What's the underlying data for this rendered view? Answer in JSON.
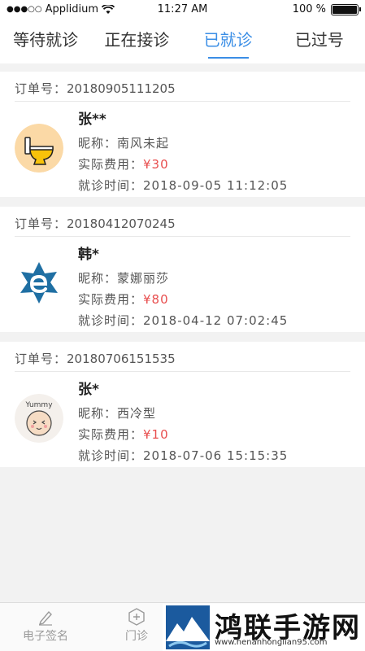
{
  "status_bar": {
    "carrier": "Applidium",
    "time": "11:27 AM",
    "battery": "100 %"
  },
  "tabs": [
    {
      "label": "等待就诊",
      "active": false
    },
    {
      "label": "正在接诊",
      "active": false
    },
    {
      "label": "已就诊",
      "active": true
    },
    {
      "label": "已过号",
      "active": false
    }
  ],
  "labels": {
    "order_no": "订单号：",
    "nickname": "昵称：",
    "fee": "实际费用：",
    "visit_time": "就诊时间："
  },
  "orders": [
    {
      "order_no": "20180905111205",
      "name": "张**",
      "nickname": "南风未起",
      "fee": "¥30",
      "visit_time": "2018-09-05  11:12:05",
      "avatar_icon": "toilet-avatar-icon"
    },
    {
      "order_no": "20180412070245",
      "name": "韩*",
      "nickname": "蒙娜丽莎",
      "fee": "¥80",
      "visit_time": "2018-04-12  07:02:45",
      "avatar_icon": "e-logo-avatar-icon"
    },
    {
      "order_no": "20180706151535",
      "name": "张*",
      "nickname": "西冷型",
      "fee": "¥10",
      "visit_time": "2018-07-06  15:15:35",
      "avatar_icon": "yummy-face-avatar-icon"
    }
  ],
  "bottom_nav": [
    {
      "label": "电子签名",
      "icon": "pen-icon"
    },
    {
      "label": "门诊",
      "icon": "plus-circle-icon"
    }
  ],
  "watermark": {
    "title": "鸿联手游网",
    "url": "www.henanhonglian95.com"
  },
  "colors": {
    "accent": "#3a8ee6",
    "fee": "#e84e4e"
  }
}
